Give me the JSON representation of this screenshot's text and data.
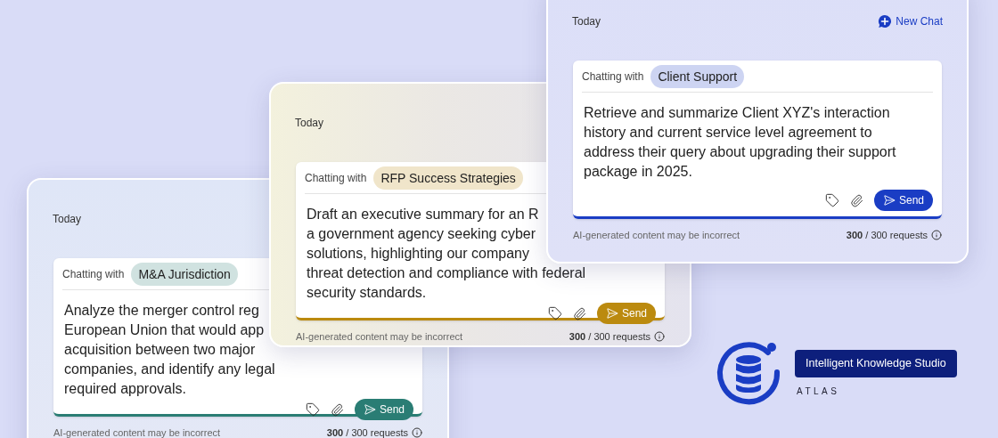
{
  "cards": [
    {
      "today": "Today",
      "chatting_label": "Chatting with",
      "assistant": "M&A Jurisdiction",
      "color": "#2a7d74",
      "prompt_lines": [
        "Analyze the merger control reg",
        "European Union that would app",
        "acquisition between two major",
        "companies, and identify any legal",
        "required approvals."
      ],
      "send": "Send",
      "disclaimer": "AI-generated content may be incorrect",
      "requests": "**300** / 300 requests"
    },
    {
      "today": "Today",
      "chatting_label": "Chatting with",
      "assistant": "RFP Success Strategies",
      "color": "#bb8a0f",
      "prompt_lines": [
        "Draft an executive summary for an R",
        "a government agency seeking cyber",
        "solutions, highlighting our company",
        "threat detection and compliance with federal",
        "security standards."
      ],
      "send": "Send",
      "disclaimer": "AI-generated content may be incorrect",
      "requests": "**300** / 300 requests"
    },
    {
      "today": "Today",
      "new_chat": "New Chat",
      "chatting_label": "Chatting with",
      "assistant": "Client Support",
      "color": "#1a3dc4",
      "prompt_lines": [
        "Retrieve and summarize Client XYZ's interaction",
        "history and current service level agreement to",
        "address their query about upgrading their support",
        "package in 2025."
      ],
      "send": "Send",
      "disclaimer": "AI-generated content may be incorrect",
      "requests": "**300** / 300 requests"
    }
  ],
  "brand": {
    "name": "Intelligent Knowledge Studio",
    "sub": "ATLAS"
  }
}
